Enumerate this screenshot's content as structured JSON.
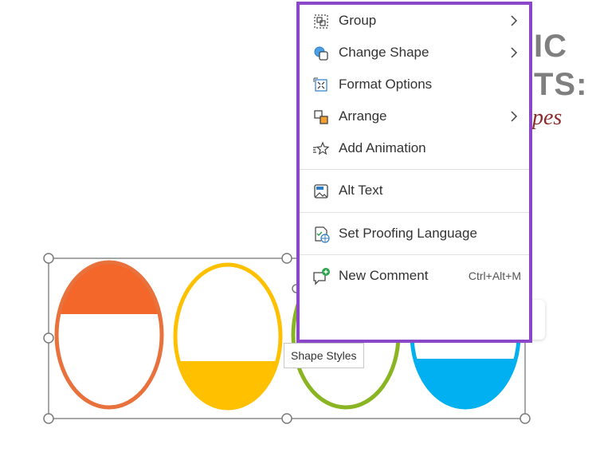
{
  "background": {
    "title_line1": "IC",
    "title_line2": "TS:",
    "subtitle": "pes"
  },
  "context_menu": {
    "items": [
      {
        "label": "Group",
        "icon": "group-icon",
        "has_submenu": true
      },
      {
        "label": "Change Shape",
        "icon": "change-shape-icon",
        "has_submenu": true
      },
      {
        "label": "Format Options",
        "icon": "format-options-icon",
        "has_submenu": false
      },
      {
        "label": "Arrange",
        "icon": "arrange-icon",
        "has_submenu": true
      },
      {
        "label": "Add Animation",
        "icon": "add-animation-icon",
        "has_submenu": false
      },
      {
        "label": "Alt Text",
        "icon": "alt-text-icon",
        "has_submenu": false
      },
      {
        "label": "Set Proofing Language",
        "icon": "proofing-language-icon",
        "has_submenu": false
      },
      {
        "label": "New Comment",
        "icon": "new-comment-icon",
        "has_submenu": false,
        "shortcut": "Ctrl+Alt+M"
      }
    ],
    "border_color": "#8b47c9"
  },
  "mini_toolbar": {
    "buttons": [
      "shape-styles-icon",
      "shape-fill-icon",
      "shape-outline-icon",
      "arrange-icon",
      "new-comment-icon"
    ]
  },
  "tooltip": {
    "text": "Shape Styles"
  },
  "shapes": {
    "colors": {
      "orange": "#f4672a",
      "orange_outline": "#e8713c",
      "yellow": "#ffc000",
      "green": "#8ab523",
      "blue": "#00b0f0"
    }
  }
}
